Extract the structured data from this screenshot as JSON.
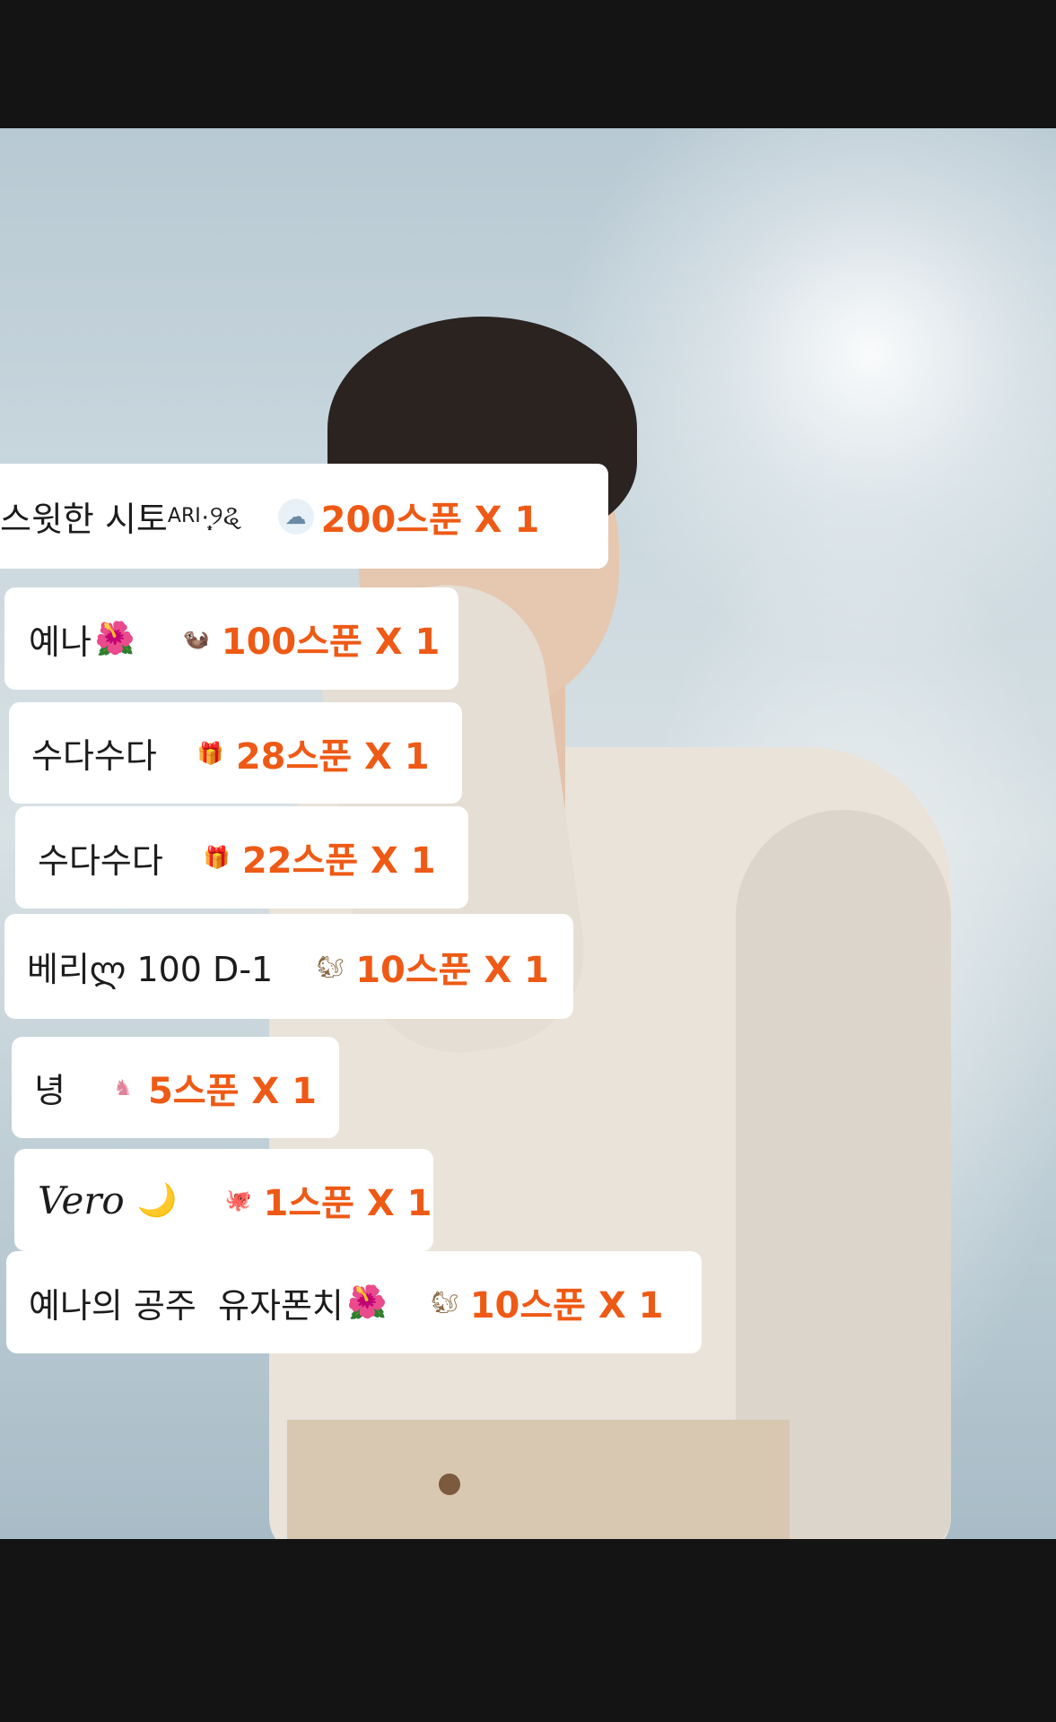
{
  "donations": [
    {
      "name": "스윗한 시토",
      "name_sup": "ARI",
      "name_suffix": "·̩͙୨ୡ",
      "gift_icon": "cloud-bird-icon",
      "gift_glyph": "☁",
      "amount": "200스푼 X 1"
    },
    {
      "name": "예나",
      "name_suffix": "🌺",
      "gift_icon": "sea-otter-icon",
      "gift_glyph": "🦦",
      "amount": "100스푼 X 1"
    },
    {
      "name": "수다수다",
      "gift_icon": "gift-boxes-icon",
      "gift_glyph": "🎁",
      "amount": "28스푼 X 1"
    },
    {
      "name": "수다수다",
      "gift_icon": "gift-boxes-icon",
      "gift_glyph": "🎁",
      "amount": "22스푼 X 1"
    },
    {
      "name": "베리ლ 100 D-1",
      "gift_icon": "squirrel-icon",
      "gift_glyph": "🐿",
      "amount": "10스푼 X 1"
    },
    {
      "name": "녕",
      "gift_icon": "seahorse-icon",
      "gift_glyph": "♞",
      "amount": "5스푼 X 1"
    },
    {
      "name": "Vero",
      "name_suffix": "🌙",
      "gift_icon": "octopus-icon",
      "gift_glyph": "🐙",
      "amount": "1스푼 X 1"
    },
    {
      "name": "예나의 공주  유자폰치",
      "name_suffix": "🌺",
      "gift_icon": "squirrel-icon",
      "gift_glyph": "🐿",
      "amount": "10스푼 X 1"
    }
  ],
  "colors": {
    "amount": "#ee5a16",
    "pill_bg": "#ffffff",
    "frame": "#141414"
  }
}
